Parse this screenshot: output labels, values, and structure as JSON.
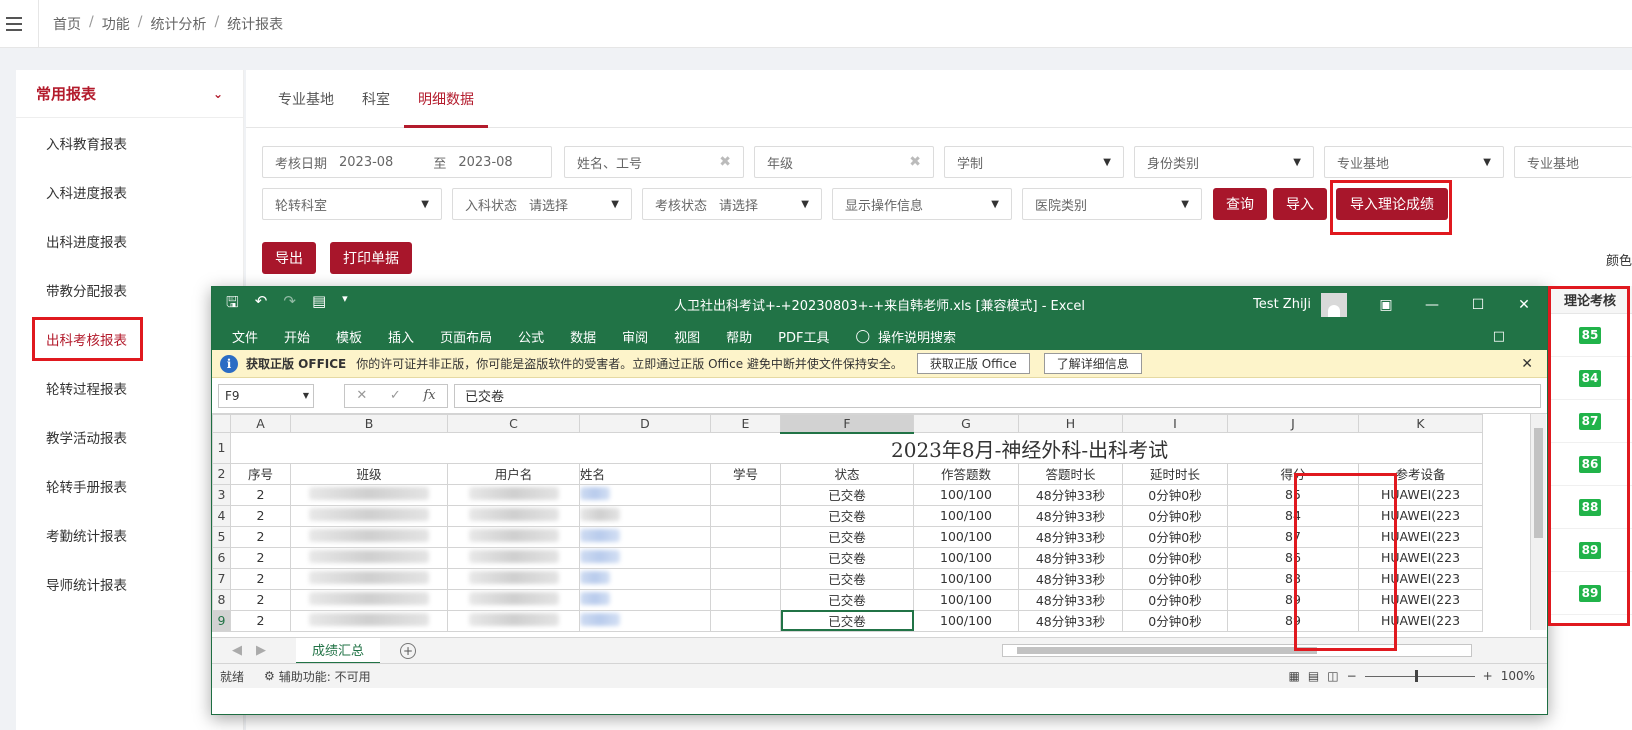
{
  "breadcrumb": [
    "首页",
    "功能",
    "统计分析",
    "统计报表"
  ],
  "sidebar": {
    "title": "常用报表",
    "items": [
      {
        "label": "入科教育报表"
      },
      {
        "label": "入科进度报表"
      },
      {
        "label": "出科进度报表"
      },
      {
        "label": "带教分配报表"
      },
      {
        "label": "出科考核报表",
        "active": true
      },
      {
        "label": "轮转过程报表"
      },
      {
        "label": "教学活动报表"
      },
      {
        "label": "轮转手册报表"
      },
      {
        "label": "考勤统计报表"
      },
      {
        "label": "导师统计报表"
      }
    ]
  },
  "tabs": [
    {
      "label": "专业基地"
    },
    {
      "label": "科室"
    },
    {
      "label": "明细数据",
      "active": true
    }
  ],
  "filters": {
    "date_label": "考核日期",
    "date_from": "2023-08",
    "date_to_sep": "至",
    "date_to": "2023-08",
    "name_placeholder": "姓名、工号",
    "grade_placeholder": "年级",
    "schooling": "学制",
    "identity": "身份类别",
    "base1": "专业基地",
    "base2": "专业基地",
    "rotation_dept": "轮转科室",
    "enter_status_label": "入科状态",
    "enter_status_value": "请选择",
    "exam_status_label": "考核状态",
    "exam_status_value": "请选择",
    "show_ops": "显示操作信息",
    "hospital_type": "医院类别"
  },
  "buttons": {
    "query": "查询",
    "import": "导入",
    "import_theory": "导入理论成绩",
    "export": "导出",
    "print": "打印单据",
    "color_label": "颜色"
  },
  "excel": {
    "title": "人卫社出科考试+-+20230803+-+来自韩老师.xls  [兼容模式]  -  Excel",
    "user": "Test ZhiJi",
    "menu": [
      "文件",
      "开始",
      "模板",
      "插入",
      "页面布局",
      "公式",
      "数据",
      "审阅",
      "视图",
      "帮助",
      "PDF工具",
      "操作说明搜索"
    ],
    "warning_bold": "获取正版 OFFICE",
    "warning_text": "你的许可证并非正版，你可能是盗版软件的受害者。立即通过正版 Office 避免中断并使文件保持安全。",
    "warning_btn1": "获取正版 Office",
    "warning_btn2": "了解详细信息",
    "namebox": "F9",
    "formula": "已交卷",
    "sheet_title": "2023年8月-神经外科-出科考试",
    "col_letters": [
      "A",
      "B",
      "C",
      "D",
      "E",
      "F",
      "G",
      "H",
      "I",
      "J",
      "K"
    ],
    "headers": [
      "序号",
      "班级",
      "用户名",
      "姓名",
      "学号",
      "状态",
      "作答题数",
      "答题时长",
      "延时时长",
      "得分",
      "参考设备"
    ],
    "rows": [
      {
        "rn": "3",
        "seq": "2",
        "status": "已交卷",
        "answered": "100/100",
        "duration": "48分钟33秒",
        "delay": "0分钟0秒",
        "score": "85",
        "device": "HUAWEI(223"
      },
      {
        "rn": "4",
        "seq": "2",
        "status": "已交卷",
        "answered": "100/100",
        "duration": "48分钟33秒",
        "delay": "0分钟0秒",
        "score": "84",
        "device": "HUAWEI(223"
      },
      {
        "rn": "5",
        "seq": "2",
        "status": "已交卷",
        "answered": "100/100",
        "duration": "48分钟33秒",
        "delay": "0分钟0秒",
        "score": "87",
        "device": "HUAWEI(223"
      },
      {
        "rn": "6",
        "seq": "2",
        "status": "已交卷",
        "answered": "100/100",
        "duration": "48分钟33秒",
        "delay": "0分钟0秒",
        "score": "86",
        "device": "HUAWEI(223"
      },
      {
        "rn": "7",
        "seq": "2",
        "status": "已交卷",
        "answered": "100/100",
        "duration": "48分钟33秒",
        "delay": "0分钟0秒",
        "score": "88",
        "device": "HUAWEI(223"
      },
      {
        "rn": "8",
        "seq": "2",
        "status": "已交卷",
        "answered": "100/100",
        "duration": "48分钟33秒",
        "delay": "0分钟0秒",
        "score": "89",
        "device": "HUAWEI(223"
      },
      {
        "rn": "9",
        "seq": "2",
        "status": "已交卷",
        "answered": "100/100",
        "duration": "48分钟33秒",
        "delay": "0分钟0秒",
        "score": "89",
        "device": "HUAWEI(223"
      }
    ],
    "sheet_tab": "成绩汇总",
    "status_ready": "就绪",
    "accessibility": "辅助功能: 不可用",
    "zoom": "100%"
  },
  "score_column": {
    "header": "理论考核",
    "values": [
      "85",
      "84",
      "87",
      "86",
      "88",
      "89",
      "89"
    ]
  }
}
